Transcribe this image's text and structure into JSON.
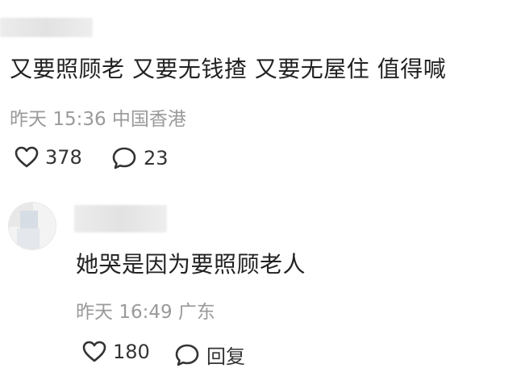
{
  "comment1": {
    "text": "又要照顾老 又要无钱揸 又要无屋住 值得喊",
    "date": "昨天",
    "time": "15:36",
    "location": "中国香港",
    "like_count": "378",
    "reply_count": "23",
    "icons": {
      "like": "heart-outline-icon",
      "reply": "speech-bubble-icon"
    }
  },
  "reply1": {
    "text": "她哭是因为要照顾老人",
    "date": "昨天",
    "time": "16:49",
    "location": "广东",
    "like_count": "180",
    "reply_label": "回复",
    "icons": {
      "like": "heart-outline-icon",
      "reply": "speech-bubble-icon"
    }
  },
  "colors": {
    "text": "#222222",
    "meta": "#9a9a9a",
    "background": "#ffffff"
  }
}
